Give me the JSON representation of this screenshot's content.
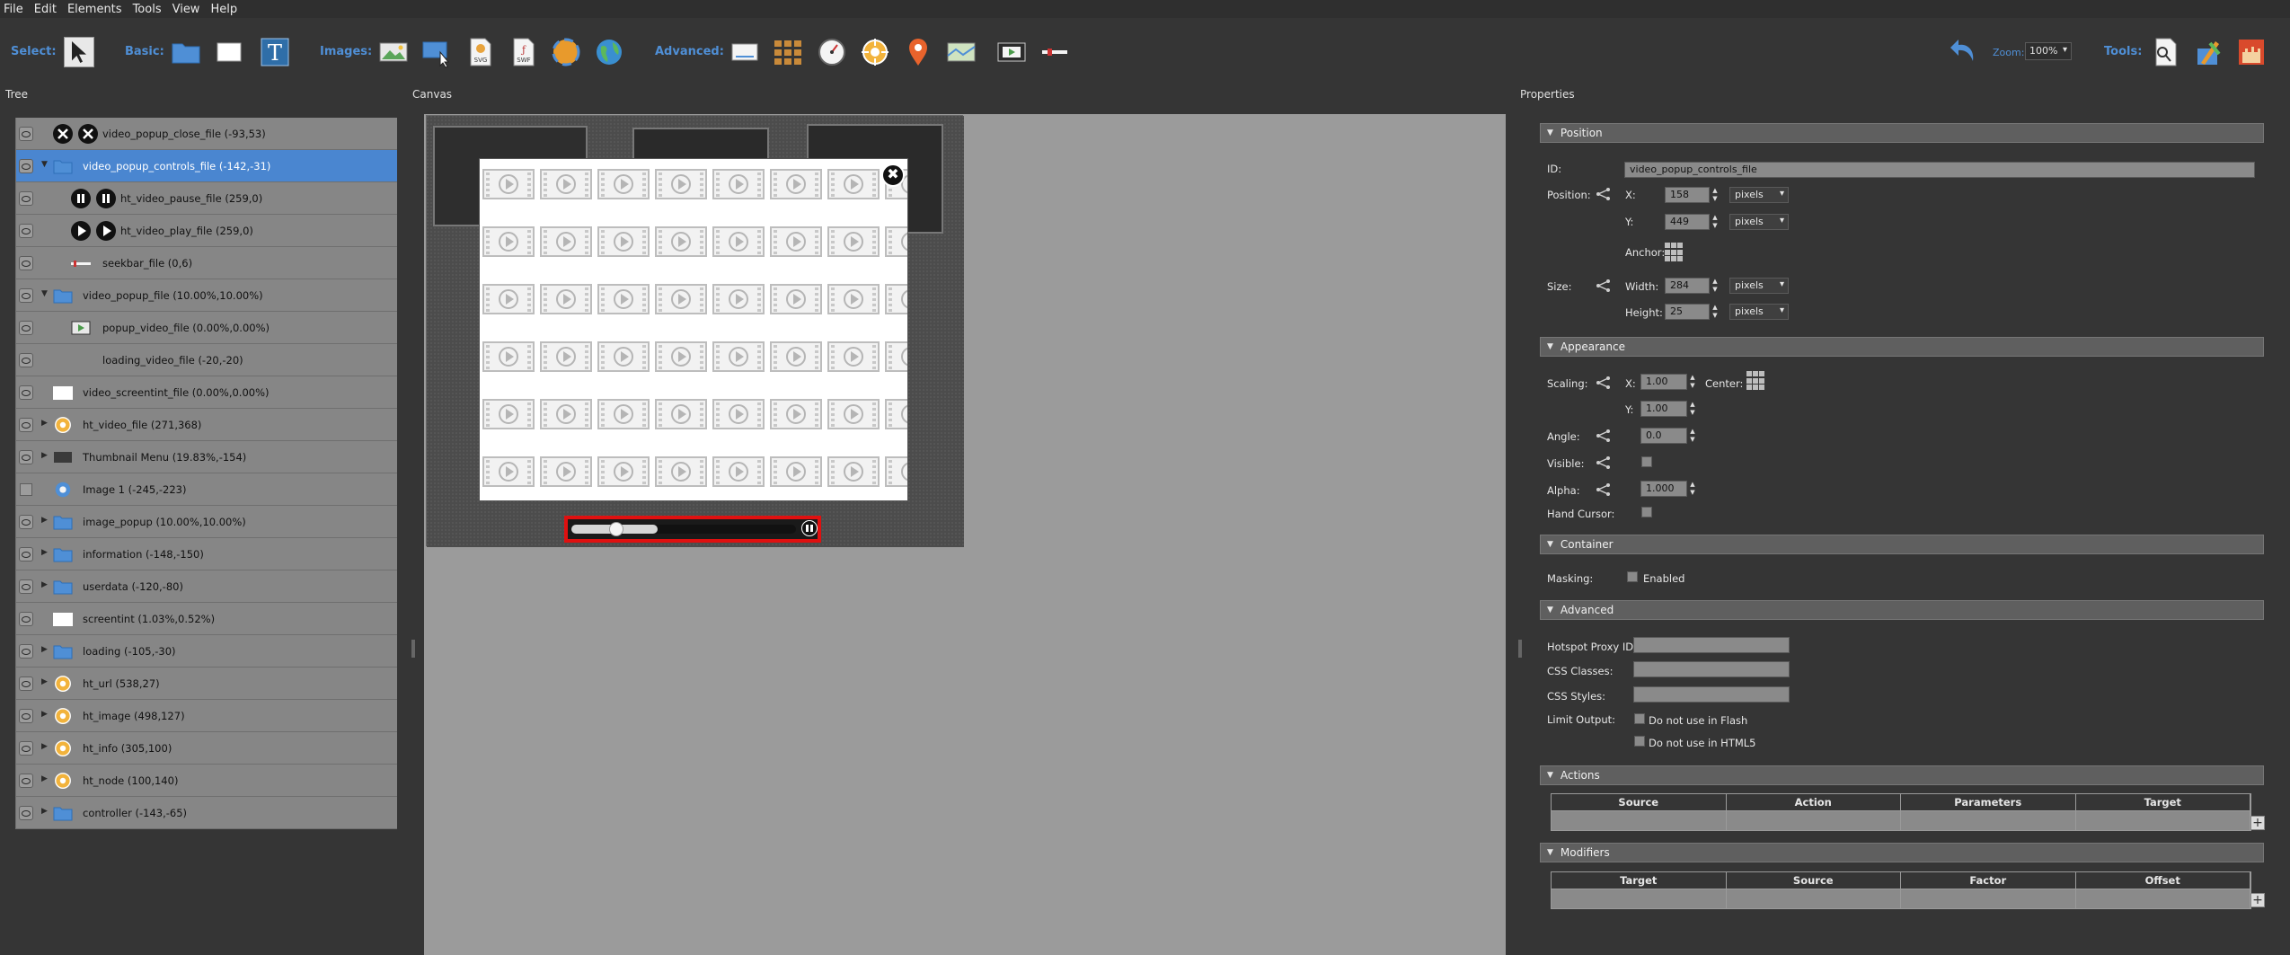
{
  "menu": [
    "File",
    "Edit",
    "Elements",
    "Tools",
    "View",
    "Help"
  ],
  "toolbar": {
    "select_label": "Select:",
    "basic_label": "Basic:",
    "images_label": "Images:",
    "advanced_label": "Advanced:",
    "zoom_label": "Zoom:",
    "zoom_value": "100%",
    "tools_label": "Tools:"
  },
  "panels": {
    "tree_title": "Tree",
    "canvas_title": "Canvas",
    "properties_title": "Properties"
  },
  "tree": [
    {
      "label": "video_popup_close_file (-93,53)",
      "icon": "close-buttons-icon",
      "arrow": "",
      "selected": false,
      "visible_eye": true
    },
    {
      "label": "video_popup_controls_file (-142,-31)",
      "icon": "folder-icon",
      "arrow": "▼",
      "selected": true,
      "visible_eye": true
    },
    {
      "label": "ht_video_pause_file (259,0)",
      "icon": "pause-buttons-icon",
      "arrow": "",
      "selected": false,
      "visible_eye": true
    },
    {
      "label": "ht_video_play_file (259,0)",
      "icon": "play-buttons-icon",
      "arrow": "",
      "selected": false,
      "visible_eye": true
    },
    {
      "label": "seekbar_file (0,6)",
      "icon": "seekbar-icon",
      "arrow": "",
      "selected": false,
      "visible_eye": true
    },
    {
      "label": "video_popup_file (10.00%,10.00%)",
      "icon": "folder-icon",
      "arrow": "▼",
      "selected": false,
      "visible_eye": true
    },
    {
      "label": "popup_video_file (0.00%,0.00%)",
      "icon": "video-icon",
      "arrow": "",
      "selected": false,
      "visible_eye": true
    },
    {
      "label": "loading_video_file (-20,-20)",
      "icon": "",
      "arrow": "",
      "selected": false,
      "visible_eye": true
    },
    {
      "label": "video_screentint_file (0.00%,0.00%)",
      "icon": "rectangle-icon",
      "arrow": "",
      "selected": false,
      "visible_eye": true
    },
    {
      "label": "ht_video_file (271,368)",
      "icon": "hotspot-icon",
      "arrow": "▶",
      "selected": false,
      "visible_eye": true
    },
    {
      "label": "Thumbnail Menu (19.83%,-154)",
      "icon": "thumbnail-icon",
      "arrow": "▶",
      "selected": false,
      "visible_eye": true
    },
    {
      "label": "Image 1 (-245,-223)",
      "icon": "image-icon",
      "arrow": "",
      "selected": false,
      "visible_eye": false
    },
    {
      "label": "image_popup (10.00%,10.00%)",
      "icon": "folder-icon",
      "arrow": "▶",
      "selected": false,
      "visible_eye": true
    },
    {
      "label": "information (-148,-150)",
      "icon": "folder-icon",
      "arrow": "▶",
      "selected": false,
      "visible_eye": true
    },
    {
      "label": "userdata (-120,-80)",
      "icon": "folder-icon",
      "arrow": "▶",
      "selected": false,
      "visible_eye": true
    },
    {
      "label": "screentint (1.03%,0.52%)",
      "icon": "rectangle-icon",
      "arrow": "",
      "selected": false,
      "visible_eye": true
    },
    {
      "label": "loading (-105,-30)",
      "icon": "folder-icon",
      "arrow": "▶",
      "selected": false,
      "visible_eye": true
    },
    {
      "label": "ht_url (538,27)",
      "icon": "hotspot-icon",
      "arrow": "▶",
      "selected": false,
      "visible_eye": true
    },
    {
      "label": "ht_image (498,127)",
      "icon": "hotspot-icon",
      "arrow": "▶",
      "selected": false,
      "visible_eye": true
    },
    {
      "label": "ht_info (305,100)",
      "icon": "hotspot-icon",
      "arrow": "▶",
      "selected": false,
      "visible_eye": true
    },
    {
      "label": "ht_node (100,140)",
      "icon": "hotspot-icon",
      "arrow": "▶",
      "selected": false,
      "visible_eye": true
    },
    {
      "label": "controller (-143,-65)",
      "icon": "folder-icon",
      "arrow": "▶",
      "selected": false,
      "visible_eye": true
    }
  ],
  "properties": {
    "position_section": "Position",
    "id_label": "ID:",
    "id_value": "video_popup_controls_file",
    "position_label": "Position:",
    "x_label": "X:",
    "x_value": "158",
    "x_unit": "pixels",
    "y_label": "Y:",
    "y_value": "449",
    "y_unit": "pixels",
    "anchor_label": "Anchor:",
    "size_label": "Size:",
    "width_label": "Width:",
    "width_value": "284",
    "width_unit": "pixels",
    "height_label": "Height:",
    "height_value": "25",
    "height_unit": "pixels",
    "appearance_section": "Appearance",
    "scaling_label": "Scaling:",
    "scale_x_label": "X:",
    "scale_x_value": "1.00",
    "center_label": "Center:",
    "scale_y_label": "Y:",
    "scale_y_value": "1.00",
    "angle_label": "Angle:",
    "angle_value": "0.0",
    "visible_label": "Visible:",
    "alpha_label": "Alpha:",
    "alpha_value": "1.000",
    "hand_cursor_label": "Hand Cursor:",
    "container_section": "Container",
    "masking_label": "Masking:",
    "masking_enabled": "Enabled",
    "advanced_section": "Advanced",
    "proxy_label": "Hotspot Proxy ID:",
    "css_classes_label": "CSS Classes:",
    "css_styles_label": "CSS Styles:",
    "limit_output_label": "Limit Output:",
    "no_flash": "Do not use in Flash",
    "no_html5": "Do not use in HTML5",
    "actions_section": "Actions",
    "actions_columns": [
      "Source",
      "Action",
      "Parameters",
      "Target"
    ],
    "modifiers_section": "Modifiers",
    "modifiers_columns": [
      "Target",
      "Source",
      "Factor",
      "Offset"
    ]
  },
  "colors": {
    "accent_blue": "#4f8fd6",
    "selection_blue": "#4a86d0",
    "controls_outline": "#e01010"
  }
}
